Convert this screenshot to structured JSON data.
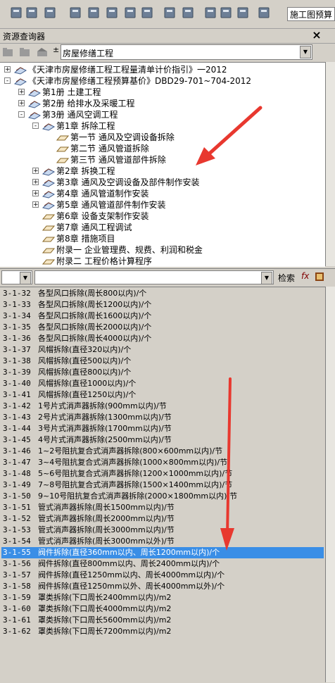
{
  "toolbar": {
    "icons": [
      "new-icon",
      "open-icon",
      "save-icon",
      "print-icon",
      "import-icon",
      "calc-icon",
      "table-icon",
      "table2-icon",
      "check-icon",
      "export-icon",
      "cut-icon",
      "copy-icon",
      "paste-icon",
      "run-icon"
    ],
    "combo_value": "施工图预算"
  },
  "panel": {
    "title": "资源查询器",
    "close": "×"
  },
  "library": {
    "selected": "房屋修缮工程"
  },
  "tree": [
    {
      "label": "《天津市房屋修缮工程工程量清单计价指引》一2012",
      "level": 0,
      "expander": "+",
      "icon": "book"
    },
    {
      "label": "《天津市房屋修缮工程预算基价》DBD29-701~704-2012",
      "level": 0,
      "expander": "-",
      "icon": "book"
    },
    {
      "label": "第1册   土建工程",
      "level": 1,
      "expander": "+",
      "icon": "book"
    },
    {
      "label": "第2册   给排水及采暖工程",
      "level": 1,
      "expander": "+",
      "icon": "book"
    },
    {
      "label": "第3册   通风空调工程",
      "level": 1,
      "expander": "-",
      "icon": "book"
    },
    {
      "label": "第1章   拆除工程",
      "level": 2,
      "expander": "-",
      "icon": "book"
    },
    {
      "label": "第一节   通风及空调设备拆除",
      "level": 3,
      "expander": "",
      "icon": "page"
    },
    {
      "label": "第二节   通风管道拆除",
      "level": 3,
      "expander": "",
      "icon": "page"
    },
    {
      "label": "第三节   通风管道部件拆除",
      "level": 3,
      "expander": "",
      "icon": "page"
    },
    {
      "label": "第2章   拆换工程",
      "level": 2,
      "expander": "+",
      "icon": "book"
    },
    {
      "label": "第3章   通风及空调设备及部件制作安装",
      "level": 2,
      "expander": "+",
      "icon": "book"
    },
    {
      "label": "第4章   通风管道制作安装",
      "level": 2,
      "expander": "+",
      "icon": "book"
    },
    {
      "label": "第5章   通风管道部件制作安装",
      "level": 2,
      "expander": "+",
      "icon": "book"
    },
    {
      "label": "第6章   设备支架制作安装",
      "level": 2,
      "expander": "",
      "icon": "page"
    },
    {
      "label": "第7章   通风工程调试",
      "level": 2,
      "expander": "",
      "icon": "page"
    },
    {
      "label": "第8章   措施项目",
      "level": 2,
      "expander": "",
      "icon": "page"
    },
    {
      "label": "附录一   企业管理费、规费、利润和税金",
      "level": 2,
      "expander": "",
      "icon": "page"
    },
    {
      "label": "附录二   工程价格计算程序",
      "level": 2,
      "expander": "",
      "icon": "page"
    }
  ],
  "filter": {
    "search_label": "检索",
    "fx": "fx"
  },
  "items": [
    {
      "code": "3-1-32",
      "name": "各型风口拆除(周长800以内)/个"
    },
    {
      "code": "3-1-33",
      "name": "各型风口拆除(周长1200以内)/个"
    },
    {
      "code": "3-1-34",
      "name": "各型风口拆除(周长1600以内)/个"
    },
    {
      "code": "3-1-35",
      "name": "各型风口拆除(周长2000以内)/个"
    },
    {
      "code": "3-1-36",
      "name": "各型风口拆除(周长4000以内)/个"
    },
    {
      "code": "3-1-37",
      "name": "风帽拆除(直径320以内)/个"
    },
    {
      "code": "3-1-38",
      "name": "风帽拆除(直径500以内)/个"
    },
    {
      "code": "3-1-39",
      "name": "风帽拆除(直径800以内)/个"
    },
    {
      "code": "3-1-40",
      "name": "风帽拆除(直径1000以内)/个"
    },
    {
      "code": "3-1-41",
      "name": "风帽拆除(直径1250以内)/个"
    },
    {
      "code": "3-1-42",
      "name": "1号片式消声器拆除(900mm以内)/节"
    },
    {
      "code": "3-1-43",
      "name": "2号片式消声器拆除(1300mm以内)/节"
    },
    {
      "code": "3-1-44",
      "name": "3号片式消声器拆除(1700mm以内)/节"
    },
    {
      "code": "3-1-45",
      "name": "4号片式消声器拆除(2500mm以内)/节"
    },
    {
      "code": "3-1-46",
      "name": "1~2号阻抗复合式消声器拆除(800×600mm以内)/节"
    },
    {
      "code": "3-1-47",
      "name": "3~4号阻抗复合式消声器拆除(1000×800mm以内)/节"
    },
    {
      "code": "3-1-48",
      "name": "5~6号阻抗复合式消声器拆除(1200×1000mm以内)/节"
    },
    {
      "code": "3-1-49",
      "name": "7~8号阻抗复合式消声器拆除(1500×1400mm以内)/节"
    },
    {
      "code": "3-1-50",
      "name": "9~10号阻抗复合式消声器拆除(2000×1800mm以内)/节"
    },
    {
      "code": "3-1-51",
      "name": "管式消声器拆除(周长1500mm以内)/节"
    },
    {
      "code": "3-1-52",
      "name": "管式消声器拆除(周长2000mm以内)/节"
    },
    {
      "code": "3-1-53",
      "name": "管式消声器拆除(周长3000mm以内)/节"
    },
    {
      "code": "3-1-54",
      "name": "管式消声器拆除(周长3000mm以外)/节"
    },
    {
      "code": "3-1-55",
      "name": "阀件拆除(直径360mm以内、周长1200mm以内)/个",
      "selected": true
    },
    {
      "code": "3-1-56",
      "name": "阀件拆除(直径800mm以内、周长2400mm以内)/个"
    },
    {
      "code": "3-1-57",
      "name": "阀件拆除(直径1250mm以内、周长4000mm以内)/个"
    },
    {
      "code": "3-1-58",
      "name": "阀件拆除(直径1250mm以外、周长4000mm以外)/个"
    },
    {
      "code": "3-1-59",
      "name": "罩类拆除(下口周长2400mm以内)/m2"
    },
    {
      "code": "3-1-60",
      "name": "罩类拆除(下口周长4000mm以内)/m2"
    },
    {
      "code": "3-1-61",
      "name": "罩类拆除(下口周长5600mm以内)/m2"
    },
    {
      "code": "3-1-62",
      "name": "罩类拆除(下口周长7200mm以内)/m2"
    }
  ],
  "colors": {
    "selection": "#3a8ee6",
    "arrow": "#e8382f"
  }
}
